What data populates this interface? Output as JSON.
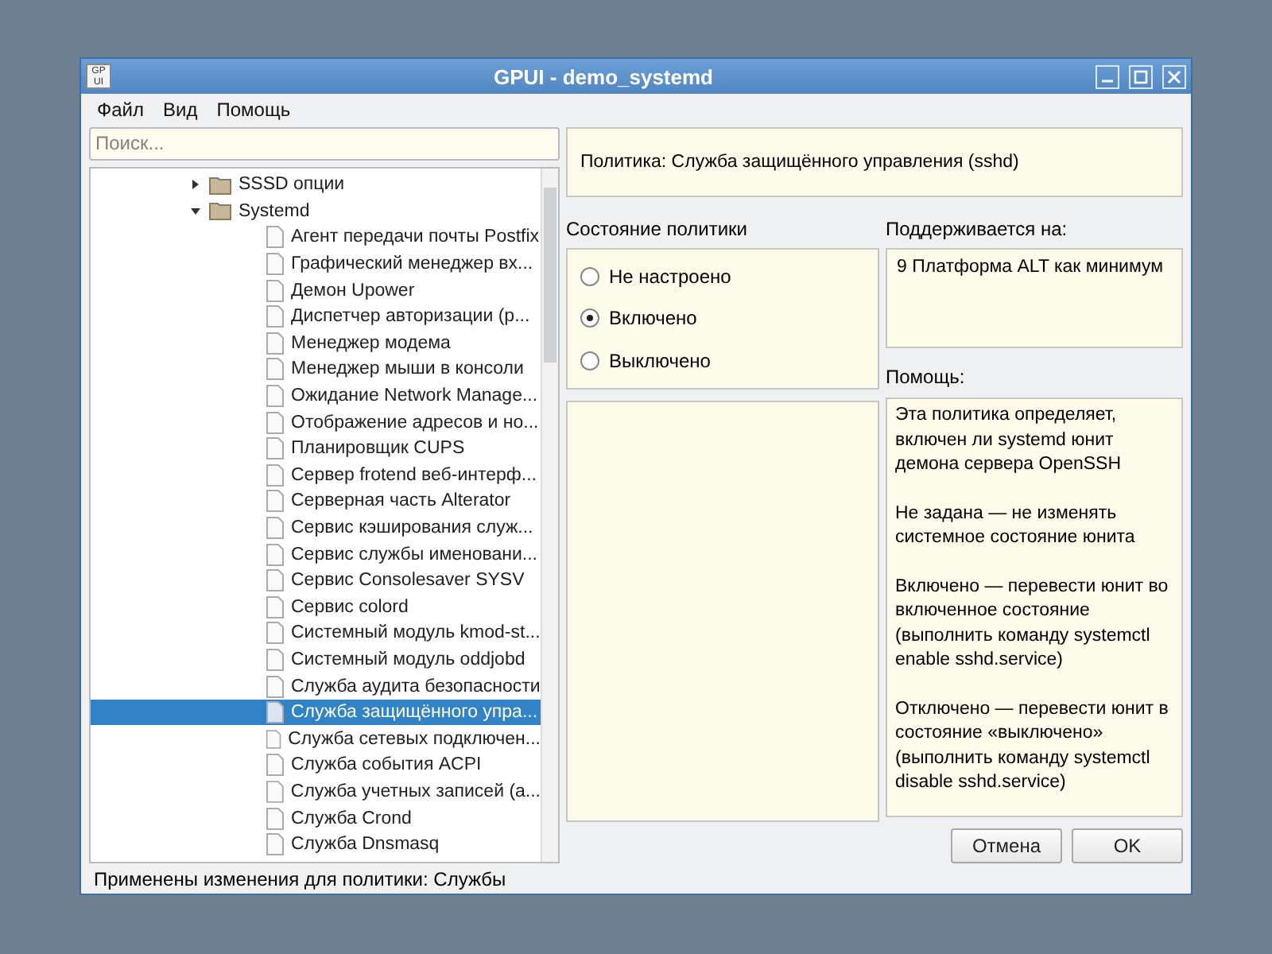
{
  "window": {
    "title": "GPUI - demo_systemd",
    "app_icon": "GP UI"
  },
  "menu": [
    {
      "label": "Файл"
    },
    {
      "label": "Вид"
    },
    {
      "label": "Помощь"
    }
  ],
  "search": {
    "placeholder": "Поиск..."
  },
  "tree": [
    {
      "label": "SSSD опции",
      "kind": "folder",
      "expanded": false,
      "selected": false
    },
    {
      "label": "Systemd",
      "kind": "folder",
      "expanded": true,
      "selected": false,
      "children": [
        {
          "label": "Агент передачи почты Postfix",
          "kind": "policy",
          "selected": false
        },
        {
          "label": "Графический менеджер вх...",
          "kind": "policy",
          "selected": false
        },
        {
          "label": "Демон Upower",
          "kind": "policy",
          "selected": false
        },
        {
          "label": "Диспетчер авторизации (р...",
          "kind": "policy",
          "selected": false
        },
        {
          "label": "Менеджер модема",
          "kind": "policy",
          "selected": false
        },
        {
          "label": "Менеджер мыши в консоли",
          "kind": "policy",
          "selected": false
        },
        {
          "label": "Ожидание Network Manage...",
          "kind": "policy",
          "selected": false
        },
        {
          "label": "Отображение адресов и но...",
          "kind": "policy",
          "selected": false
        },
        {
          "label": "Планировщик CUPS",
          "kind": "policy",
          "selected": false
        },
        {
          "label": "Сервер frotend веб-интерф...",
          "kind": "policy",
          "selected": false
        },
        {
          "label": "Серверная часть Alterator",
          "kind": "policy",
          "selected": false
        },
        {
          "label": "Сервис кэширования служ...",
          "kind": "policy",
          "selected": false
        },
        {
          "label": "Сервис службы именовани...",
          "kind": "policy",
          "selected": false
        },
        {
          "label": "Сервис Consolesaver SYSV",
          "kind": "policy",
          "selected": false
        },
        {
          "label": "Сервис colord",
          "kind": "policy",
          "selected": false
        },
        {
          "label": "Системный модуль kmod-st...",
          "kind": "policy",
          "selected": false
        },
        {
          "label": "Системный модуль oddjobd",
          "kind": "policy",
          "selected": false
        },
        {
          "label": "Служба аудита безопасности",
          "kind": "policy",
          "selected": false
        },
        {
          "label": "Служба защищённого упра...",
          "kind": "policy",
          "selected": true
        },
        {
          "label": "Служба сетевых подключен...",
          "kind": "policy",
          "selected": false
        },
        {
          "label": "Служба события ACPI",
          "kind": "policy",
          "selected": false
        },
        {
          "label": "Служба учетных записей (а...",
          "kind": "policy",
          "selected": false
        },
        {
          "label": "Служба Crond",
          "kind": "policy",
          "selected": false
        },
        {
          "label": "Служба Dnsmasq",
          "kind": "policy",
          "selected": false
        }
      ]
    }
  ],
  "policy_title": "Политика: Служба защищённого управления (sshd)",
  "state_label": "Состояние политики",
  "states": [
    {
      "label": "Не настроено",
      "selected": false
    },
    {
      "label": "Включено",
      "selected": true
    },
    {
      "label": "Выключено",
      "selected": false
    }
  ],
  "supported_label": "Поддерживается на:",
  "supported": "9 Платформа ALT как минимум",
  "help_label": "Помощь:",
  "help": [
    "Эта политика определяет, включен ли systemd юнит демона сервера OpenSSH",
    "Не задана — не изменять системное состояние юнита",
    "Включено — перевести юнит во включенное состояние (выполнить команду systemctl enable sshd.service)",
    "Отключено — перевести юнит в состояние «выключено» (выполнить команду systemctl disable sshd.service)"
  ],
  "buttons": [
    {
      "label": "Отмена"
    },
    {
      "label": "OK"
    }
  ],
  "status_bar": "Применены изменения для политики: Службы"
}
